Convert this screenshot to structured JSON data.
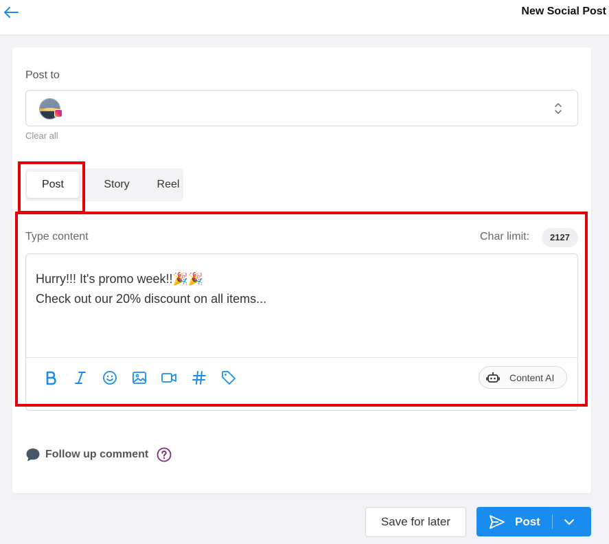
{
  "header": {
    "title": "New Social Post"
  },
  "post_to": {
    "label": "Post to",
    "clear_all": "Clear all"
  },
  "tabs": [
    {
      "label": "Post",
      "active": true
    },
    {
      "label": "Story",
      "active": false
    },
    {
      "label": "Reel",
      "active": false
    }
  ],
  "content": {
    "label": "Type content",
    "char_limit_label": "Char limit:",
    "char_limit_value": "2127",
    "text_line1": "Hurry!!! It's promo week!!🎉🎉",
    "text_line2": "Check out our 20% discount on all items..."
  },
  "toolbar": {
    "icons": [
      "bold-icon",
      "italic-icon",
      "emoji-icon",
      "image-icon",
      "video-icon",
      "hashtag-icon",
      "tag-icon"
    ],
    "content_ai_label": "Content AI"
  },
  "follow_up": {
    "label": "Follow up comment"
  },
  "actions": {
    "save_label": "Save for later",
    "post_label": "Post"
  },
  "colors": {
    "accent": "#1a8cf0",
    "highlight": "#e5000b",
    "help": "#7a2a82"
  }
}
